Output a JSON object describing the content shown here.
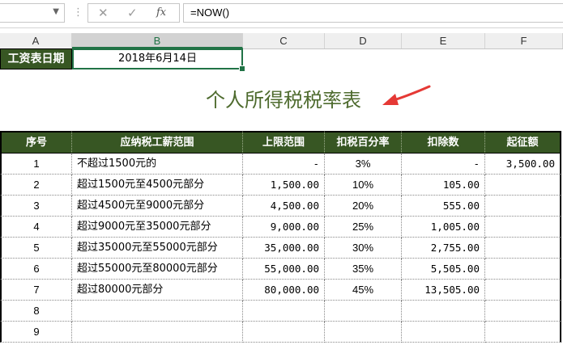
{
  "formula_bar": {
    "formula": "=NOW()",
    "name_box": "",
    "cancel_icon": "✕",
    "enter_icon": "✓",
    "function_icon": "fx"
  },
  "columns": [
    "A",
    "B",
    "C",
    "D",
    "E",
    "F"
  ],
  "active_column": "B",
  "date_row": {
    "label": "工资表日期",
    "value": "2018年6月14日"
  },
  "title": "个人所得税税率表",
  "table": {
    "headers": [
      "序号",
      "应纳税工薪范围",
      "上限范围",
      "扣税百分率",
      "扣除数",
      "起征额"
    ],
    "rows": [
      [
        "1",
        "不超过1500元的",
        "-",
        "3%",
        "-",
        "3,500.00"
      ],
      [
        "2",
        "超过1500元至4500元部分",
        "1,500.00",
        "10%",
        "105.00",
        ""
      ],
      [
        "3",
        "超过4500元至9000元部分",
        "4,500.00",
        "20%",
        "555.00",
        ""
      ],
      [
        "4",
        "超过9000元至35000元部分",
        "9,000.00",
        "25%",
        "1,005.00",
        ""
      ],
      [
        "5",
        "超过35000元至55000元部分",
        "35,000.00",
        "30%",
        "2,755.00",
        ""
      ],
      [
        "6",
        "超过55000元至80000元部分",
        "55,000.00",
        "35%",
        "5,505.00",
        ""
      ],
      [
        "7",
        "超过80000元部分",
        "80,000.00",
        "45%",
        "13,505.00",
        ""
      ],
      [
        "8",
        "",
        "",
        "",
        "",
        ""
      ],
      [
        "9",
        "",
        "",
        "",
        "",
        ""
      ]
    ]
  },
  "colors": {
    "header_bg": "#375623",
    "title_color": "#4e6b2e",
    "arrow_color": "#e53935",
    "selection": "#217346"
  }
}
